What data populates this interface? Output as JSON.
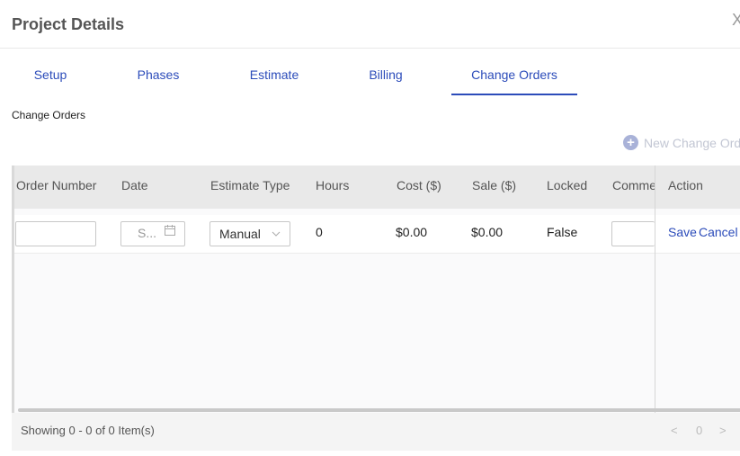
{
  "header": {
    "title": "Project Details",
    "close_label": "X"
  },
  "tabs": [
    {
      "label": "Setup"
    },
    {
      "label": "Phases"
    },
    {
      "label": "Estimate"
    },
    {
      "label": "Billing"
    },
    {
      "label": "Change Orders",
      "active": true
    }
  ],
  "section": {
    "label": "Change Orders",
    "new_button_label": "New Change Order",
    "new_button_icon": "plus-circle-icon"
  },
  "table": {
    "columns": [
      "Order Number",
      "Date",
      "Estimate Type",
      "Hours",
      "Cost ($)",
      "Sale ($)",
      "Locked",
      "Comments",
      "Action"
    ],
    "edit_row": {
      "order_number": "",
      "date_placeholder": "S...",
      "estimate_type": "Manual",
      "hours": "0",
      "cost": "$0.00",
      "sale": "$0.00",
      "locked": "False",
      "comments": "",
      "save_label": "Save",
      "cancel_label": "Cancel"
    }
  },
  "footer": {
    "summary": "Showing 0 - 0 of 0 Item(s)",
    "prev_label": "<",
    "page": "0",
    "next_label": ">"
  },
  "colors": {
    "accent": "#2c4cba",
    "header_bg": "#e9e9e9",
    "footer_bg": "#f4f4f4"
  }
}
